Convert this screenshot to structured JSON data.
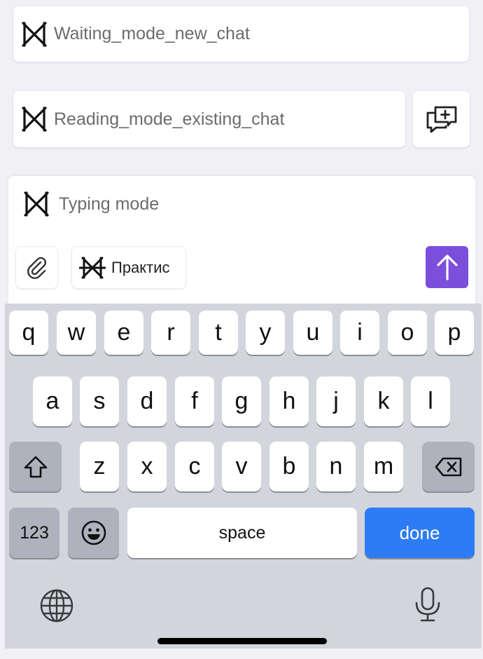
{
  "chat_list": {
    "waiting": {
      "label": "Waiting_mode_new_chat",
      "icon": "bowtie-icon"
    },
    "reading": {
      "label": "Reading_mode_existing_chat",
      "icon": "bowtie-icon"
    },
    "new_chat_button": {
      "icon": "new-chat-icon"
    }
  },
  "composer": {
    "label": "Typing mode",
    "icon": "bowtie-icon",
    "attach_icon": "paperclip-icon",
    "practice_chip": {
      "label": "Практис",
      "icon": "bowtie-crossed-icon"
    },
    "send_icon": "arrow-up-icon",
    "accent_color": "#7b4fdc"
  },
  "keyboard": {
    "row1": [
      "q",
      "w",
      "e",
      "r",
      "t",
      "y",
      "u",
      "i",
      "o",
      "p"
    ],
    "row2": [
      "a",
      "s",
      "d",
      "f",
      "g",
      "h",
      "j",
      "k",
      "l"
    ],
    "row3": [
      "z",
      "x",
      "c",
      "v",
      "b",
      "n",
      "m"
    ],
    "shift_icon": "shift-icon",
    "delete_icon": "backspace-icon",
    "numbers_label": "123",
    "emoji_icon": "emoji-icon",
    "space_label": "space",
    "done_label": "done",
    "done_color": "#2d7cf6",
    "globe_icon": "globe-icon",
    "mic_icon": "microphone-icon"
  }
}
